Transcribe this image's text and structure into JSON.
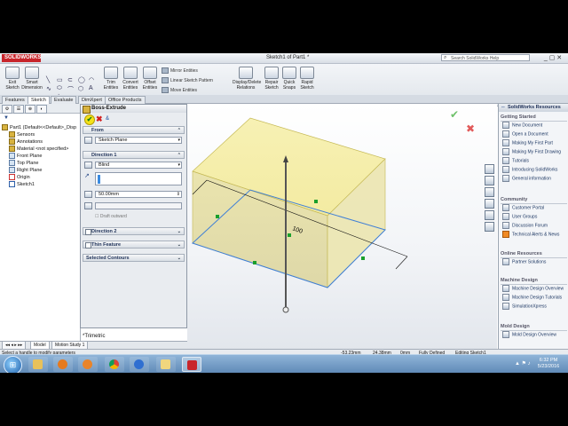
{
  "app": {
    "logo": "SOLIDWORKS",
    "document_title": "Sketch1 of Part1 *",
    "search_placeholder": "Search SolidWorks Help",
    "window_controls": "_ ▢ ✕"
  },
  "ribbon": {
    "exit_sketch": "Exit Sketch",
    "smart_dimension": "Smart Dimension",
    "trim_entities": "Trim Entities",
    "convert_entities": "Convert Entities",
    "offset_entities": "Offset Entities",
    "mirror_entities": "Mirror Entities",
    "linear_sketch_pattern": "Linear Sketch Pattern",
    "move_entities": "Move Entities",
    "display_delete_relations": "Display/Delete Relations",
    "repair_sketch": "Repair Sketch",
    "quick_snaps": "Quick Snaps",
    "rapid_sketch": "Rapid Sketch"
  },
  "tabs": [
    "Features",
    "Sketch",
    "Evaluate",
    "DimXpert",
    "Office Products"
  ],
  "active_tab": "Sketch",
  "tree": {
    "root": "Part1  (Default<<Default>_Disp",
    "items": [
      "Sensors",
      "Annotations",
      "Material <not specified>",
      "Front Plane",
      "Top Plane",
      "Right Plane",
      "Origin",
      "Sketch1"
    ]
  },
  "property_manager": {
    "title": "Boss-Extrude",
    "ok_tooltip": "OK",
    "from_section": "From",
    "from_value": "Sketch Plane",
    "direction1_section": "Direction 1",
    "end_condition": "Blind",
    "depth_value": "50.00mm",
    "draft_outward": "Draft outward",
    "direction2_section": "Direction 2",
    "thin_feature_section": "Thin Feature",
    "selected_contours_section": "Selected Contours"
  },
  "graphics": {
    "dimension_label": "100",
    "view_orientation": "*Trimetric"
  },
  "task_pane": {
    "title": "SolidWorks Resources",
    "sections": {
      "getting_started": {
        "title": "Getting Started",
        "items": [
          "New Document",
          "Open a Document",
          "Making My First Part",
          "Making My First Drawing",
          "Tutorials",
          "Introducing SolidWorks",
          "General information"
        ]
      },
      "community": {
        "title": "Community",
        "items": [
          "Customer Portal",
          "User Groups",
          "Discussion Forum",
          "Technical Alerts & News"
        ]
      },
      "online_resources": {
        "title": "Online Resources",
        "items": [
          "Partner Solutions"
        ]
      },
      "machine_design": {
        "title": "Machine Design",
        "items": [
          "Machine Design Overview",
          "Machine Design Tutorials",
          "SimulationXpress"
        ]
      },
      "mold_design": {
        "title": "Mold Design",
        "items": [
          "Mold Design Overview"
        ]
      }
    }
  },
  "bottom_tabs": [
    "Model",
    "Motion Study 1"
  ],
  "status": {
    "message": "Select a handle to modify parameters",
    "x": "-53.23mm",
    "y": "24.38mm",
    "z": "0mm",
    "state": "Fully Defined",
    "editing": "Editing Sketch1"
  },
  "taskbar": {
    "time": "6:32 PM",
    "date": "5/23/2016",
    "apps": [
      "windows-explorer",
      "firefox",
      "media-player",
      "chrome",
      "other-browser",
      "folder",
      "solidworks"
    ]
  },
  "colors": {
    "extrude_preview": "#f5eea0",
    "sketch_blue": "#3f7fd6",
    "brand_red": "#c8252b"
  }
}
